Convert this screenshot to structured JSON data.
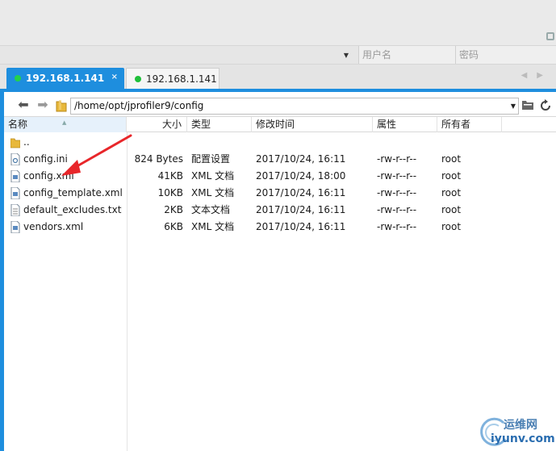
{
  "credentials": {
    "username_placeholder": "用户名",
    "password_placeholder": "密码"
  },
  "tabs": [
    {
      "label": "192.168.1.141",
      "active": true,
      "close": "×"
    },
    {
      "label": "192.168.1.141",
      "active": false
    }
  ],
  "toolbar": {
    "path": "/home/opt/jprofiler9/config"
  },
  "columns": {
    "name": "名称",
    "size": "大小",
    "type": "类型",
    "mtime": "修改时间",
    "attr": "属性",
    "owner": "所有者"
  },
  "files": [
    {
      "name": "..",
      "size": "",
      "type": "",
      "mtime": "",
      "attr": "",
      "owner": "",
      "icon": "folder-icon"
    },
    {
      "name": "config.ini",
      "size": "824 Bytes",
      "type": "配置设置",
      "mtime": "2017/10/24, 16:11",
      "attr": "-rw-r--r--",
      "owner": "root",
      "icon": "settings-file-icon"
    },
    {
      "name": "config.xml",
      "size": "41KB",
      "type": "XML 文档",
      "mtime": "2017/10/24, 18:00",
      "attr": "-rw-r--r--",
      "owner": "root",
      "icon": "xml-file-icon"
    },
    {
      "name": "config_template.xml",
      "size": "10KB",
      "type": "XML 文档",
      "mtime": "2017/10/24, 16:11",
      "attr": "-rw-r--r--",
      "owner": "root",
      "icon": "xml-file-icon"
    },
    {
      "name": "default_excludes.txt",
      "size": "2KB",
      "type": "文本文档",
      "mtime": "2017/10/24, 16:11",
      "attr": "-rw-r--r--",
      "owner": "root",
      "icon": "text-file-icon"
    },
    {
      "name": "vendors.xml",
      "size": "6KB",
      "type": "XML 文档",
      "mtime": "2017/10/24, 16:11",
      "attr": "-rw-r--r--",
      "owner": "root",
      "icon": "xml-file-icon"
    }
  ],
  "watermark": {
    "cn": "运维网",
    "en": "iyunv.com"
  },
  "colors": {
    "accent": "#1e8ede",
    "arrow": "#e8262a",
    "status_dot": "#1fbf3a"
  }
}
